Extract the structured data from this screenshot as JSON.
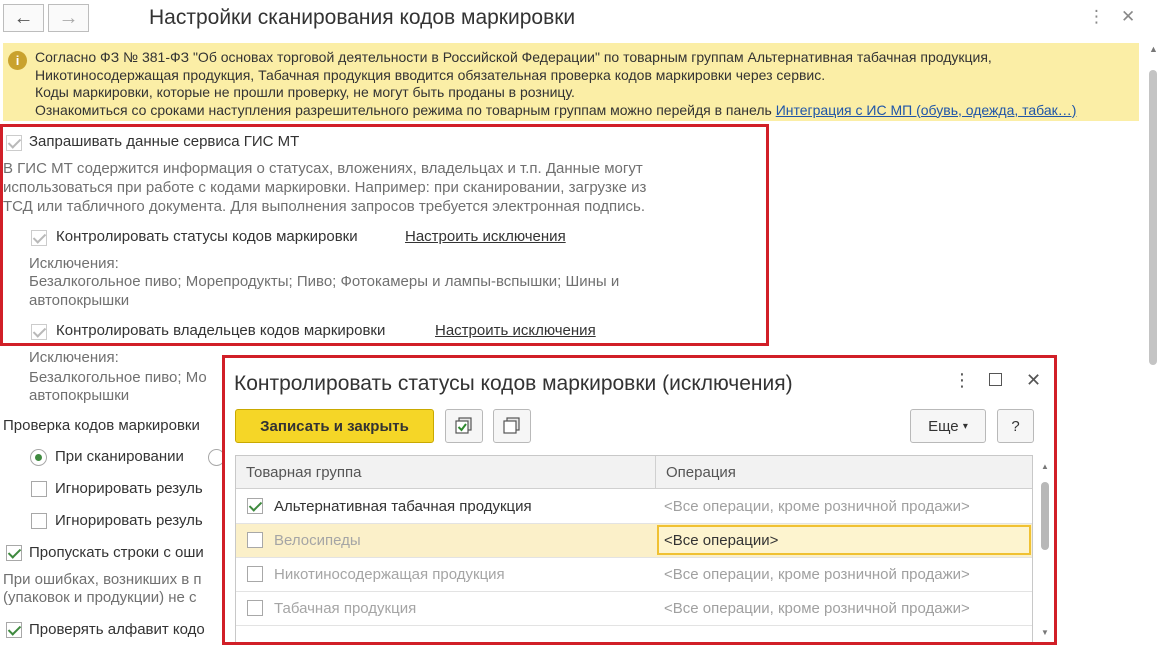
{
  "window": {
    "title": "Настройки сканирования кодов маркировки",
    "back_glyph": "←",
    "forward_glyph": "→",
    "more_glyph": "⋮",
    "close_glyph": "✕"
  },
  "banner": {
    "icon_glyph": "i",
    "line1": "Согласно ФЗ № 381-ФЗ \"Об основах торговой деятельности в Российской Федерации\" по товарным группам Альтернативная табачная продукция,",
    "line2": "Никотиносодержащая продукция, Табачная продукция вводится обязательная проверка кодов маркировки через сервис.",
    "line3": "Коды маркировки, которые не прошли проверку, не могут быть проданы в розницу.",
    "line4_prefix": "Ознакомиться со сроками наступления разрешительного режима по товарным группам можно перейдя в панель ",
    "line4_link": "Интеграция с ИС МП (обувь, одежда, табак…)"
  },
  "gis": {
    "request_label": "Запрашивать данные сервиса ГИС МТ",
    "desc1": "В ГИС МТ содержится информация о статусах, вложениях, владельцах и т.п. Данные могут",
    "desc2": "использоваться при работе с кодами маркировки. Например: при сканировании, загрузке из",
    "desc3": "ТСД или табличного документа. Для выполнения запросов требуется электронная подпись.",
    "status_label": "Контролировать статусы кодов маркировки",
    "status_link": "Настроить исключения",
    "exc_title": "Исключения:",
    "exc1_line1": "Безалкогольное пиво; Морепродукты; Пиво; Фотокамеры и лампы-вспышки; Шины и",
    "exc1_line2": "автопокрышки",
    "owner_label": "Контролировать владельцев кодов маркировки",
    "owner_link": "Настроить исключения",
    "exc2_title": "Исключения:",
    "exc2_line1": "Безалкогольное пиво; Мо",
    "exc2_line2": "автопокрышки"
  },
  "check": {
    "title": "Проверка кодов маркировки",
    "on_scan": "При сканировании",
    "ignore1": "Игнорировать резуль",
    "ignore2": "Игнорировать резуль",
    "skip_label": "Пропускать строки с оши",
    "err1": "При ошибках, возникших в п",
    "err2": "(упаковок и продукции) не с",
    "alphabet_label": "Проверять алфавит кодо"
  },
  "dialog": {
    "title": "Контролировать статусы кодов маркировки (исключения)",
    "save_close": "Записать и закрыть",
    "more": "Еще",
    "more_arrow": "▾",
    "help": "?",
    "col_group": "Товарная группа",
    "col_operation": "Операция",
    "rows": [
      {
        "group": "Альтернативная табачная продукция",
        "operation": "<Все операции, кроме розничной продажи>"
      },
      {
        "group": "Велосипеды",
        "operation": "<Все операции>"
      },
      {
        "group": "Никотиносодержащая продукция",
        "operation": "<Все операции, кроме розничной продажи>"
      },
      {
        "group": "Табачная продукция",
        "operation": "<Все операции, кроме розничной продажи>"
      }
    ]
  }
}
